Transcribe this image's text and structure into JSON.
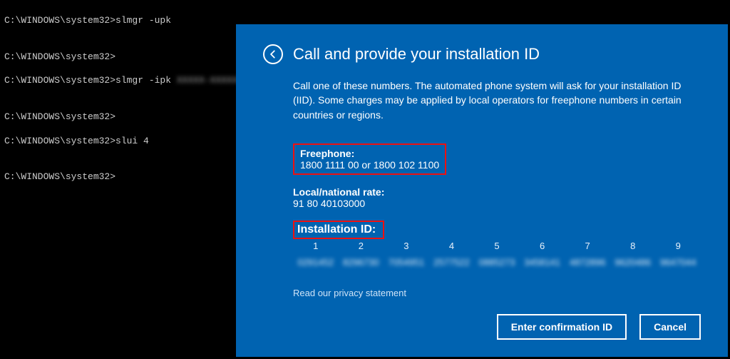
{
  "terminal": {
    "lines": [
      "C:\\WINDOWS\\system32>slmgr -upk",
      "",
      "C:\\WINDOWS\\system32>",
      "C:\\WINDOWS\\system32>slmgr -ipk ",
      "",
      "C:\\WINDOWS\\system32>",
      "C:\\WINDOWS\\system32>slui 4",
      "",
      "C:\\WINDOWS\\system32>"
    ],
    "blurred_key": "XXXXX-XXXXX-XX"
  },
  "dialog": {
    "title": "Call and provide your installation ID",
    "body": "Call one of these numbers. The automated phone system will ask for your installation ID (IID). Some charges may be applied by local operators for freephone numbers in certain countries or regions.",
    "freephone_label": "Freephone:",
    "freephone_value": "1800 1111 00 or 1800 102 1100",
    "local_label": "Local/national rate:",
    "local_value": "91 80 40103000",
    "install_label": "Installation ID:",
    "columns": [
      "1",
      "2",
      "3",
      "4",
      "5",
      "6",
      "7",
      "8",
      "9"
    ],
    "values": [
      "0291452",
      "8296730",
      "7054951",
      "2577522",
      "0885273",
      "3458141",
      "4872896",
      "9620486",
      "9647044"
    ],
    "privacy": "Read our privacy statement",
    "enter_btn": "Enter confirmation ID",
    "cancel_btn": "Cancel"
  }
}
